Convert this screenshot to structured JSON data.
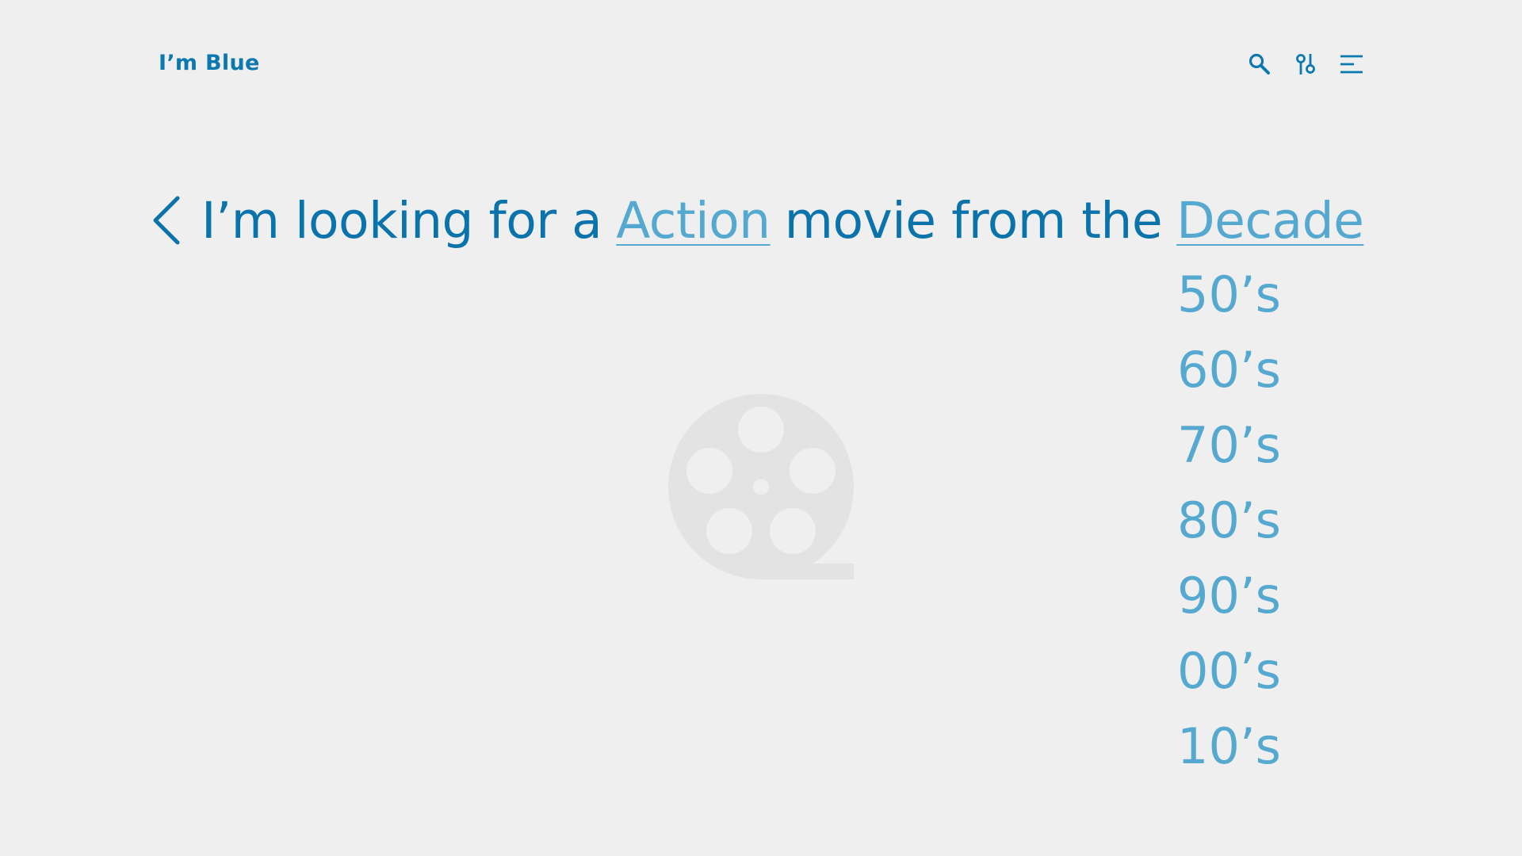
{
  "header": {
    "logo": "I’m Blue",
    "icons": [
      "search-icon",
      "filter-icon",
      "menu-icon"
    ]
  },
  "query": {
    "back_icon": "chevron-left-icon",
    "text_1": "I’m looking for a",
    "genre": "Action",
    "text_2": "movie from the",
    "decade": "Decade"
  },
  "decade_options": [
    "50’s",
    "60’s",
    "70’s",
    "80’s",
    "90’s",
    "00’s",
    "10’s"
  ],
  "placeholder_icon": "film-reel-icon",
  "colors": {
    "background": "#efefef",
    "primary": "#0b73ab",
    "accent": "#55a9d0",
    "placeholder": "#e3e3e3"
  }
}
